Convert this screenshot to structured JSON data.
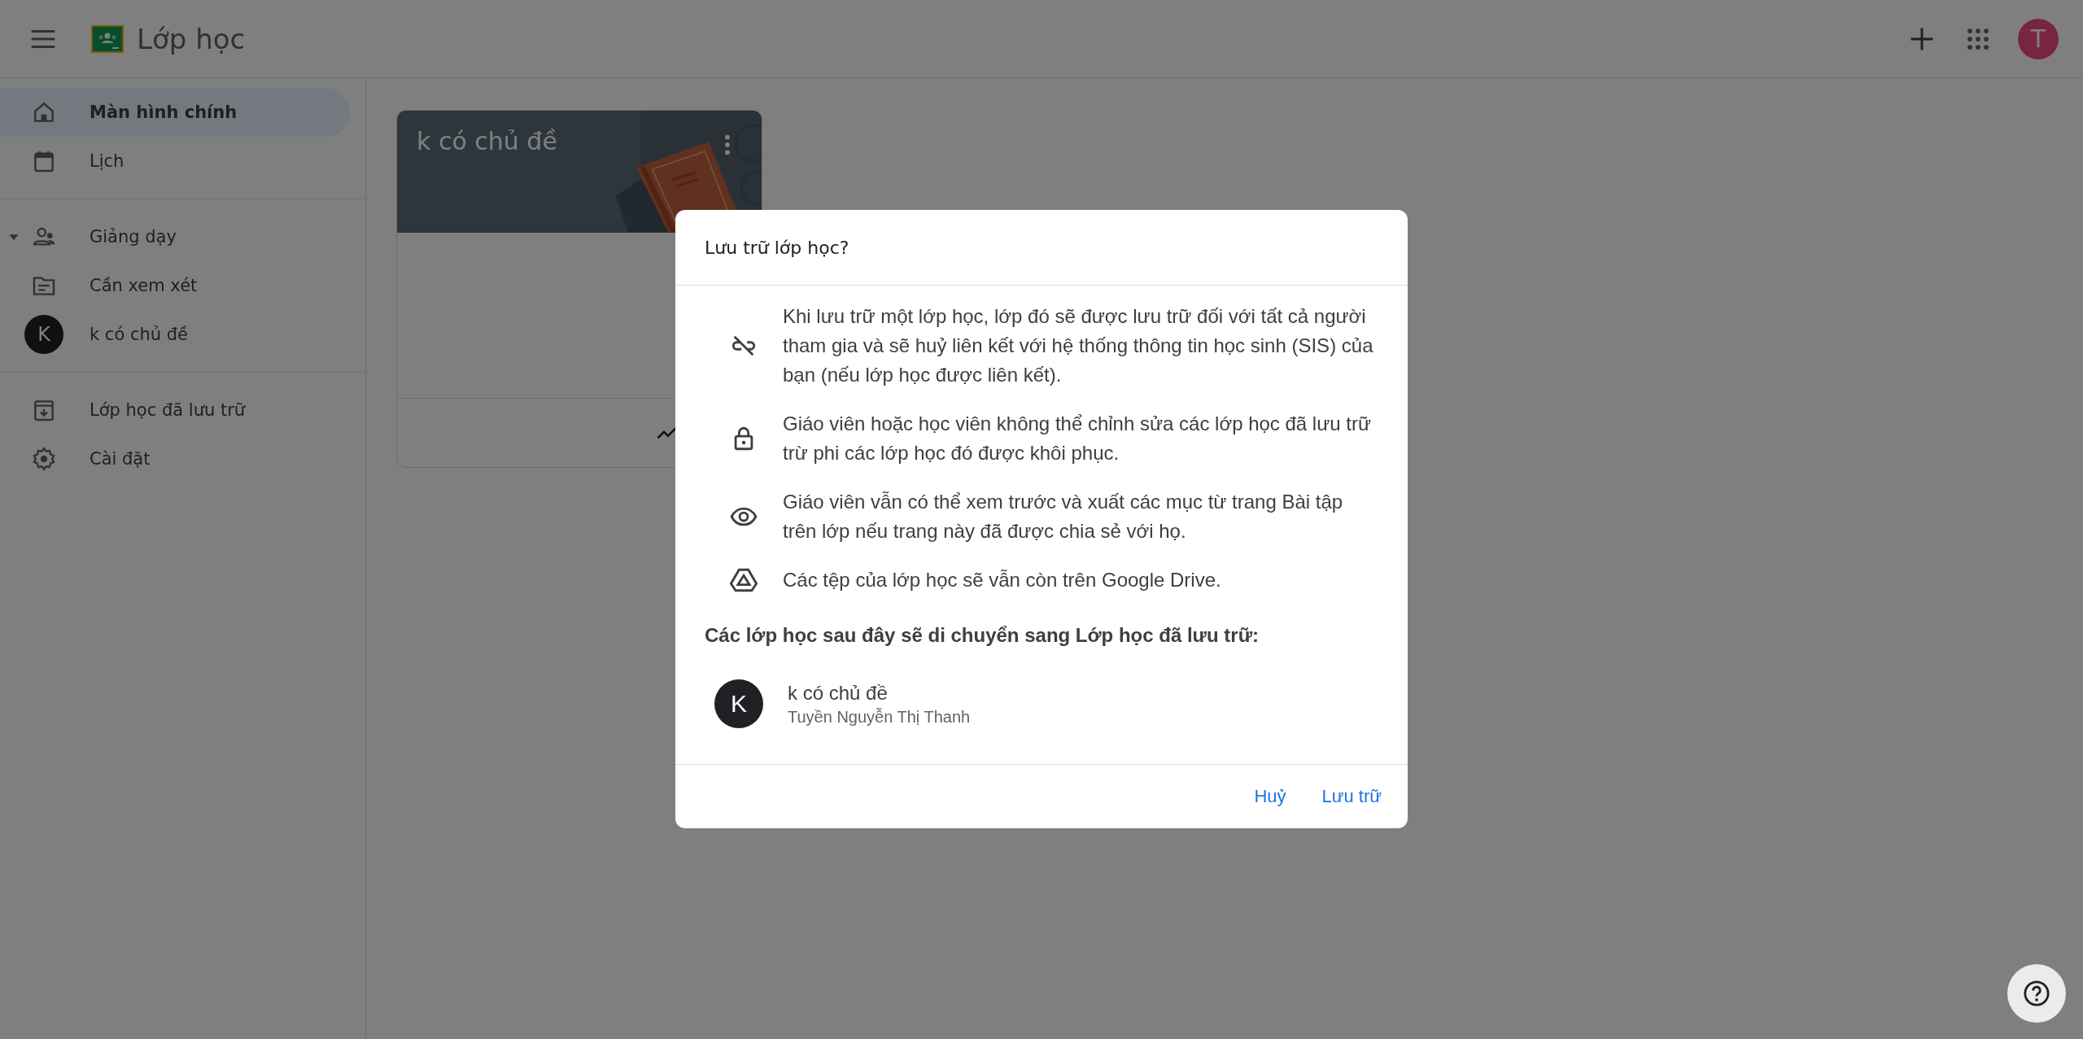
{
  "header": {
    "title": "Lớp học",
    "avatar_letter": "T"
  },
  "sidebar": {
    "sections": [
      {
        "items": [
          {
            "kind": "home",
            "label": "Màn hình chính",
            "selected": true
          },
          {
            "kind": "calendar",
            "label": "Lịch",
            "selected": false
          }
        ]
      },
      {
        "heading": {
          "label": "Giảng dạy",
          "expanded": true
        },
        "items": [
          {
            "kind": "review",
            "label": "Cần xem xét",
            "selected": false
          },
          {
            "kind": "class",
            "letter": "K",
            "label": "k có chủ đề",
            "selected": false
          }
        ]
      },
      {
        "items": [
          {
            "kind": "archive",
            "label": "Lớp học đã lưu trữ",
            "selected": false
          },
          {
            "kind": "settings",
            "label": "Cài đặt",
            "selected": false
          }
        ]
      }
    ]
  },
  "card": {
    "title": "k có chủ đề"
  },
  "dialog": {
    "title": "Lưu trữ lớp học?",
    "points": [
      {
        "kind": "unlink",
        "text": "Khi lưu trữ một lớp học, lớp đó sẽ được lưu trữ đối với tất cả người tham gia và sẽ huỷ liên kết với hệ thống thông tin học sinh (SIS) của bạn (nếu lớp học được liên kết)."
      },
      {
        "kind": "lock",
        "text": "Giáo viên hoặc học viên không thể chỉnh sửa các lớp học đã lưu trữ trừ phi các lớp học đó được khôi phục."
      },
      {
        "kind": "eye",
        "text": "Giáo viên vẫn có thể xem trước và xuất các mục từ trang Bài tập trên lớp nếu trang này đã được chia sẻ với họ."
      },
      {
        "kind": "drive",
        "text": "Các tệp của lớp học sẽ vẫn còn trên Google Drive."
      }
    ],
    "list_heading": "Các lớp học sau đây sẽ di chuyển sang Lớp học đã lưu trữ:",
    "classes": [
      {
        "letter": "K",
        "name": "k có chủ đề",
        "teacher": "Tuyền Nguyễn Thị Thanh"
      }
    ],
    "buttons": [
      "Huỷ",
      "Lưu trữ"
    ]
  }
}
